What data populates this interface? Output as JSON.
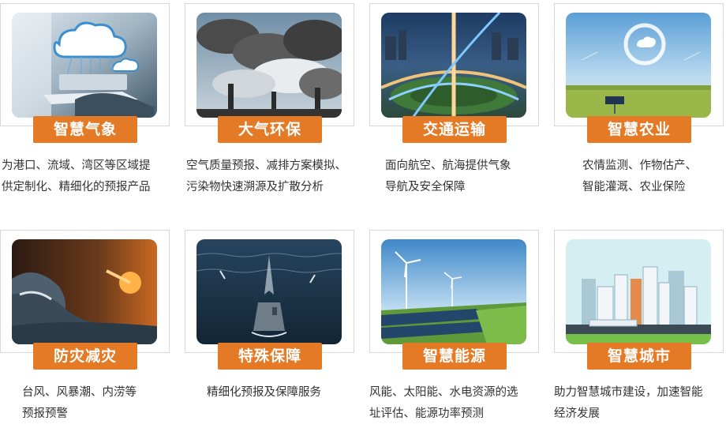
{
  "cards": [
    {
      "title": "智慧气象",
      "lines": [
        "为港口、流域、湾区等区域提",
        "供定制化、精细化的预报产品"
      ],
      "image": "cloud-computing-icon"
    },
    {
      "title": "大气环保",
      "lines": [
        "空气质量预报、减排方案模拟、",
        "污染物快速溯源及扩散分析"
      ],
      "image": "factory-smoke-icon"
    },
    {
      "title": "交通运输",
      "lines": [
        "面向航空、航海提供气象",
        "导航及安全保障"
      ],
      "image": "highway-interchange-icon"
    },
    {
      "title": "智慧农业",
      "lines": [
        "农情监测、作物估产、",
        "智能灌溉、农业保险"
      ],
      "image": "farmland-sensor-icon"
    },
    {
      "title": "防灾减灾",
      "lines": [
        "台风、风暴潮、内涝等",
        "预报预警"
      ],
      "image": "storm-wave-icon"
    },
    {
      "title": "特殊保障",
      "lines": [
        "精细化预报及保障服务"
      ],
      "image": "aircraft-carrier-icon"
    },
    {
      "title": "智慧能源",
      "lines": [
        "风能、太阳能、水电资源的选",
        "址评估、能源功率预测"
      ],
      "image": "wind-solar-icon"
    },
    {
      "title": "智慧城市",
      "lines": [
        "助力智慧城市建设，加速智能",
        "经济发展"
      ],
      "image": "city-skyline-icon"
    }
  ]
}
